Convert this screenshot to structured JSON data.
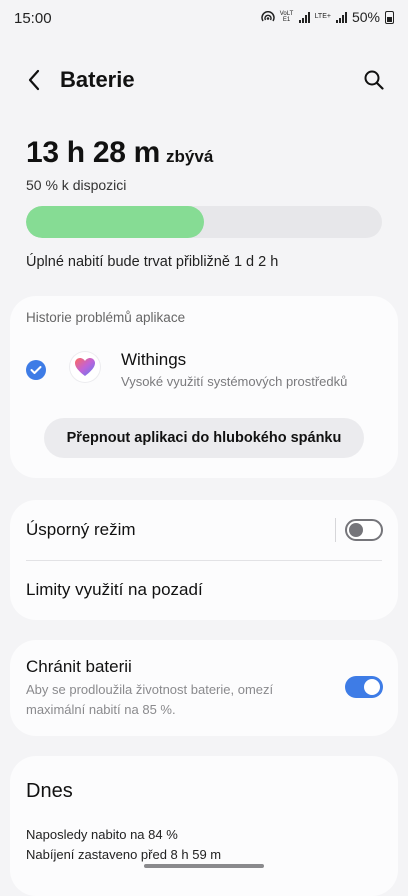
{
  "status_bar": {
    "time": "15:00",
    "volte_label": "VoLTE1",
    "lte_label": "LTE+",
    "battery_percent": "50%"
  },
  "header": {
    "title": "Baterie"
  },
  "battery": {
    "remaining_time": "13 h 28 m",
    "remaining_suffix": "zbývá",
    "available": "50 % k dispozici",
    "level_percent": 50,
    "charge_estimate": "Úplné nabití bude trvat přibližně 1 d 2 h"
  },
  "app_history": {
    "section_label": "Historie problémů aplikace",
    "app_name": "Withings",
    "app_description": "Vysoké využití systémových prostředků",
    "action_label": "Přepnout aplikaci do hlubokého spánku"
  },
  "settings": {
    "power_saving_label": "Úsporný režim",
    "power_saving_enabled": false,
    "background_limits_label": "Limity využití na pozadí",
    "protect_battery_label": "Chránit baterii",
    "protect_battery_desc": "Aby se prodloužila životnost baterie, omezí maximální nabití na 85 %.",
    "protect_battery_enabled": true
  },
  "today": {
    "title": "Dnes",
    "last_charged": "Naposledy nabito na 84 %",
    "charging_stopped": "Nabíjení zastaveno před 8 h 59 m"
  },
  "colors": {
    "accent": "#3e7ce6",
    "battery_fill": "#86dc94"
  }
}
